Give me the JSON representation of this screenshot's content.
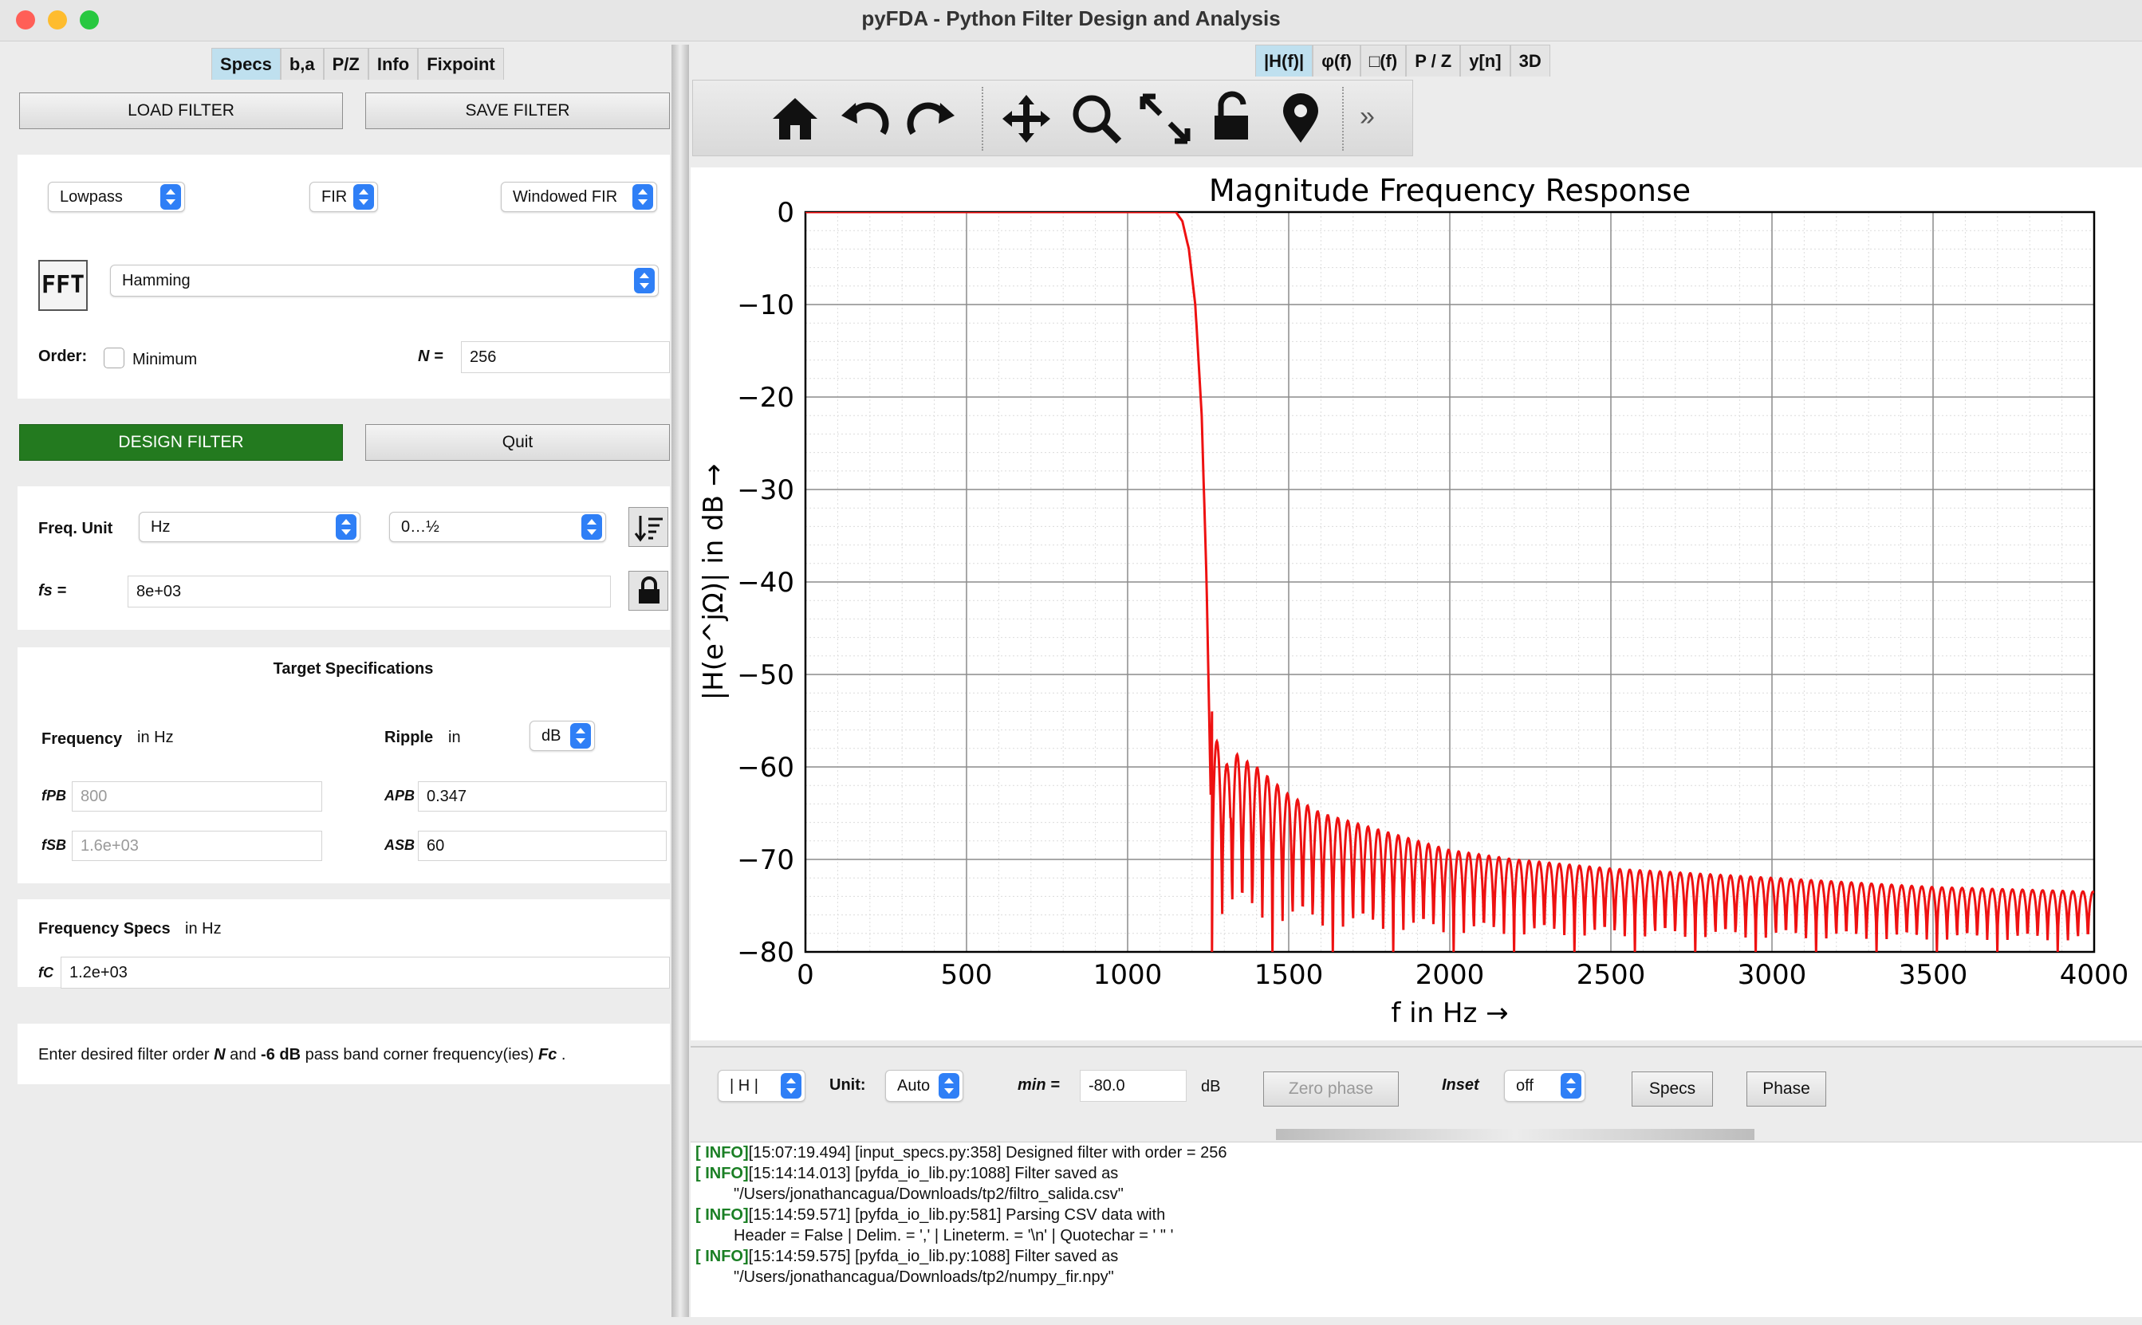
{
  "window": {
    "title": "pyFDA - Python Filter Design and Analysis"
  },
  "left_tabs": [
    "Specs",
    "b,a",
    "P/Z",
    "Info",
    "Fixpoint"
  ],
  "right_tabs": [
    "|H(f)|",
    "φ(f)",
    "□(f)",
    "P / Z",
    "y[n]",
    "3D"
  ],
  "buttons": {
    "load": "LOAD FILTER",
    "save": "SAVE FILTER",
    "design": "DESIGN FILTER",
    "quit": "Quit"
  },
  "filter": {
    "response_type": "Lowpass",
    "filter_type": "FIR",
    "design_method": "Windowed FIR",
    "fft_label": "FFT",
    "window": "Hamming",
    "order_label": "Order:",
    "minimum_label": "Minimum",
    "n_label": "N =",
    "n_value": "256"
  },
  "freq": {
    "unit_label": "Freq. Unit",
    "unit": "Hz",
    "range": "0…½",
    "fs_label": "fs =",
    "fs_value": "8e+03"
  },
  "target": {
    "title": "Target Specifications",
    "freq_label": "Frequency",
    "freq_unit": "in Hz",
    "ripple_label": "Ripple",
    "ripple_in": "in",
    "ripple_unit": "dB",
    "fpb_label": "fPB",
    "fpb_value": "800",
    "fsb_label": "fSB",
    "fsb_value": "1.6e+03",
    "apb_label": "APB",
    "apb_value": "0.347",
    "asb_label": "ASB",
    "asb_value": "60"
  },
  "freq_specs": {
    "title": "Frequency Specs",
    "unit": "in Hz",
    "fc_label": "fC",
    "fc_value": "1.2e+03"
  },
  "info_text": {
    "a": "Enter desired filter order ",
    "n": "N",
    "b": " and ",
    "c": "-6 dB",
    "d": " pass band corner frequency(ies) ",
    "fc": "Fc",
    "e": " ."
  },
  "toolbar_icons": [
    "home-icon",
    "back-icon",
    "forward-icon",
    "pan-icon",
    "zoom-icon",
    "fullscreen-icon",
    "lock-icon",
    "pin-icon",
    "more-icon"
  ],
  "controls": {
    "h_select": "| H |",
    "unit_label": "Unit:",
    "unit_value": "Auto",
    "min_label": "min =",
    "min_value": "-80.0",
    "db_label": "dB",
    "zero_phase": "Zero phase",
    "inset_label": "Inset",
    "inset_value": "off",
    "specs_btn": "Specs",
    "phase_btn": "Phase"
  },
  "log": [
    {
      "tag": "[ INFO]",
      "text": "[15:07:19.494] [input_specs.py:358] Designed filter with order = 256"
    },
    {
      "tag": "[ INFO]",
      "text": "[15:14:14.013] [pyfda_io_lib.py:1088] Filter saved as"
    },
    {
      "tag": "",
      "text": "\"/Users/jonathancagua/Downloads/tp2/filtro_salida.csv\""
    },
    {
      "tag": "[ INFO]",
      "text": "[15:14:59.571] [pyfda_io_lib.py:581] Parsing CSV data with"
    },
    {
      "tag": "",
      "text": "Header = False | Delim. = ',' | Lineterm. = '\\n' | Quotechar = ' \" '"
    },
    {
      "tag": "[ INFO]",
      "text": "[15:14:59.575] [pyfda_io_lib.py:1088] Filter saved as"
    },
    {
      "tag": "",
      "text": "\"/Users/jonathancagua/Downloads/tp2/numpy_fir.npy\""
    }
  ],
  "colors": {
    "accent_tab": "#bfe0ef",
    "design_button": "#237a1f",
    "curve": "#ee1111",
    "log_tag": "#1a7f24"
  },
  "chart_data": {
    "type": "line",
    "title": "Magnitude Frequency Response",
    "xlabel": "f in Hz →",
    "ylabel": "|H(e^jΩ)| in dB →",
    "xlim": [
      0,
      4000
    ],
    "ylim": [
      -80,
      0
    ],
    "xticks": [
      "0",
      "500",
      "1000",
      "1500",
      "2000",
      "2500",
      "3000",
      "3500",
      "4000"
    ],
    "yticks": [
      "0",
      "−10",
      "−20",
      "−30",
      "−40",
      "−50",
      "−60",
      "−70",
      "−80"
    ],
    "grid": true,
    "series": [
      {
        "x": [
          0,
          1000,
          1150,
          1170,
          1190,
          1210,
          1230,
          1245,
          1258,
          1262,
          1268,
          1280,
          1300,
          1320,
          1350,
          1400,
          1500,
          1600,
          1700,
          1800,
          2000,
          2200,
          2500,
          3000,
          3500,
          4000
        ],
        "y": [
          0,
          0,
          0,
          -1,
          -4,
          -10,
          -22,
          -40,
          -63,
          -54,
          -58,
          -62,
          -80,
          -58,
          -59,
          -60,
          -63,
          -65,
          -66,
          -67,
          -69,
          -70,
          -71,
          -72,
          -73,
          -73.5
        ],
        "note": "envelope of stopband sidelobes oscillating down to -80 dB"
      }
    ]
  }
}
